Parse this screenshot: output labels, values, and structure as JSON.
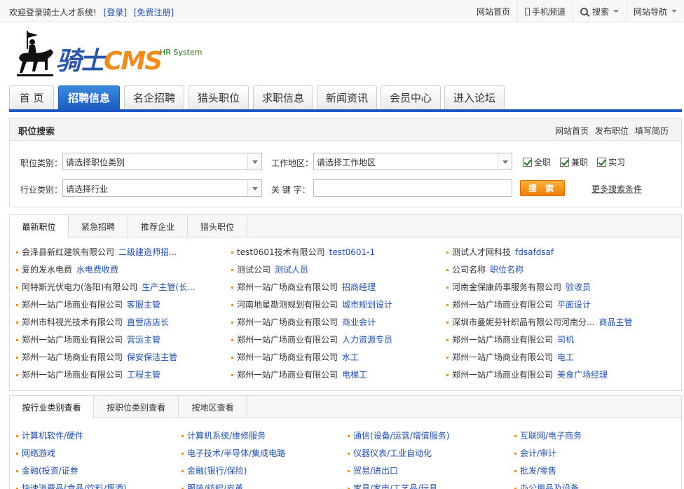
{
  "topbar": {
    "welcome": "欢迎登录骑士人才系统!",
    "login": "[登录]",
    "register": "[免费注册]",
    "home": "网站首页",
    "mobile": "手机频道",
    "search": "搜索",
    "sitenav": "网站导航"
  },
  "logo": {
    "main": "骑士",
    "cms": "CMS",
    "sub": "HR System"
  },
  "nav": [
    "首 页",
    "招聘信息",
    "名企招聘",
    "猎头职位",
    "求职信息",
    "新闻资讯",
    "会员中心",
    "进入论坛"
  ],
  "search": {
    "title": "职位搜索",
    "links": [
      "网站首页",
      "发布职位",
      "填写简历"
    ],
    "category_label": "职位类别：",
    "category_value": "请选择职位类别",
    "area_label": "工作地区：",
    "area_value": "请选择工作地区",
    "industry_label": "行业类别：",
    "industry_value": "请选择行业",
    "keyword_label": "关 键 字：",
    "keyword_value": "",
    "checks": [
      "全职",
      "兼职",
      "实习"
    ],
    "button": "搜 索",
    "more": "更多搜索条件"
  },
  "jobs": {
    "tabs": [
      "最新职位",
      "紧急招聘",
      "推荐企业",
      "猎头职位"
    ],
    "rows": [
      [
        [
          "会泽县新红建筑有限公司",
          "二级建造师招..."
        ],
        [
          "test0601技术有限公司",
          "test0601-1"
        ],
        [
          "测试人才网科技",
          "fdsafdsaf"
        ]
      ],
      [
        [
          "爱的发水电费",
          "水电费收费"
        ],
        [
          "测试公司",
          "测试人员"
        ],
        [
          "公司名称",
          "职位名称"
        ]
      ],
      [
        [
          "阿特斯光伏电力(洛阳)有限公司",
          "生产主管(长..."
        ],
        [
          "郑州一站广场商业有限公司",
          "招商经理"
        ],
        [
          "河南金保康药事服务有限公司",
          "验收员"
        ]
      ],
      [
        [
          "郑州一站广场商业有限公司",
          "客服主管"
        ],
        [
          "河南地星勘测规划有限公司",
          "城市规划设计"
        ],
        [
          "郑州一站广场商业有限公司",
          "平面设计"
        ]
      ],
      [
        [
          "郑州市科视光技术有限公司",
          "直营店店长"
        ],
        [
          "郑州一站广场商业有限公司",
          "商业会计"
        ],
        [
          "深圳市曼妮芬针织品有限公司河南分...",
          "商品主管"
        ]
      ],
      [
        [
          "郑州一站广场商业有限公司",
          "营运主管"
        ],
        [
          "郑州一站广场商业有限公司",
          "人力资源专员"
        ],
        [
          "郑州一站广场商业有限公司",
          "司机"
        ]
      ],
      [
        [
          "郑州一站广场商业有限公司",
          "保安保洁主管"
        ],
        [
          "郑州一站广场商业有限公司",
          "水工"
        ],
        [
          "郑州一站广场商业有限公司",
          "电工"
        ]
      ],
      [
        [
          "郑州一站广场商业有限公司",
          "工程主管"
        ],
        [
          "郑州一站广场商业有限公司",
          "电梯工"
        ],
        [
          "郑州一站广场商业有限公司",
          "美食广场经理"
        ]
      ]
    ]
  },
  "categories": {
    "tabs": [
      "按行业类别查看",
      "按职位类别查看",
      "按地区查看"
    ],
    "rows": [
      [
        "计算机软件/硬件",
        "计算机系统/维修服务",
        "通信(设备/运营/增值服务)",
        "互联网/电子商务"
      ],
      [
        "网络游戏",
        "电子技术/半导体/集成电路",
        "仪器仪表/工业自动化",
        "会计/审计"
      ],
      [
        "金融(投资/证券",
        "金融(银行/保险)",
        "贸易/进出口",
        "批发/零售"
      ],
      [
        "快速消费品(食品/饮料/烟酒)",
        "服装/纺织/皮革",
        "家具/家电/工艺品/玩具",
        "办公用品及设备"
      ]
    ]
  }
}
